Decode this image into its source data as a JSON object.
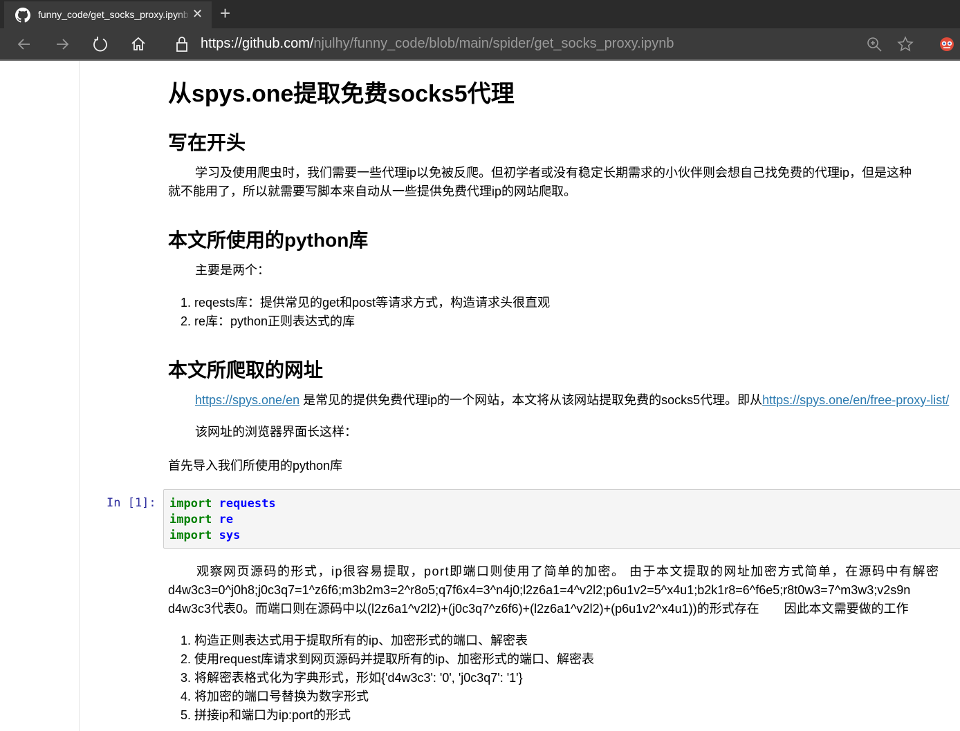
{
  "browser": {
    "tab_title": "funny_code/get_socks_proxy.ipynb",
    "tab_close": "✕",
    "new_tab": "+",
    "url_host": "https://github.com/",
    "url_path": "njulhy/funny_code/blob/main/spider/get_socks_proxy.ipynb"
  },
  "notebook": {
    "title": "从spys.one提取免费socks5代理",
    "section1_heading": "写在开头",
    "section1_para_line1": "学习及使用爬虫时，我们需要一些代理ip以免被反爬。但初学者或没有稳定长期需求的小伙伴则会想自己找免费的代理ip，但是这种",
    "section1_para_line2": "就不能用了，所以就需要写脚本来自动从一些提供免费代理ip的网站爬取。",
    "section2_heading": "本文所使用的python库",
    "section2_intro": "主要是两个：",
    "libs": [
      "reqests库：提供常见的get和post等请求方式，构造请求头很直观",
      "re库：python正则表达式的库"
    ],
    "section3_heading": "本文所爬取的网址",
    "section3_link1": "https://spys.one/en",
    "section3_text": " 是常见的提供免费代理ip的一个网站，本文将从该网站提取免费的socks5代理。即从",
    "section3_link2": "https://spys.one/en/free-proxy-list/",
    "section3_browser_note": "该网址的浏览器界面长这样：",
    "import_intro": "首先导入我们所使用的python库",
    "cell_prompt": "In [1]:",
    "code_lines": [
      {
        "keyword": "import",
        "module": "requests"
      },
      {
        "keyword": "import",
        "module": "re"
      },
      {
        "keyword": "import",
        "module": "sys"
      }
    ],
    "analysis_line1": "观察网页源码的形式，ip很容易提取，port即端口则使用了简单的加密。 由于本文提取的网址加密方式简单，在源码中有解密",
    "analysis_line2": "d4w3c3=0^j0h8;j0c3q7=1^z6f6;m3b2m3=2^r8o5;q7f6x4=3^n4j0;l2z6a1=4^v2l2;p6u1v2=5^x4u1;b2k1r8=6^f6e5;r8t0w3=7^m3w3;v2s9n",
    "analysis_line3": "d4w3c3代表0。而端口则在源码中以(l2z6a1^v2l2)+(j0c3q7^z6f6)+(l2z6a1^v2l2)+(p6u1v2^x4u1))的形式存在　　因此本文需要做的工作",
    "steps": [
      "构造正则表达式用于提取所有的ip、加密形式的端口、解密表",
      "使用request库请求到网页源码并提取所有的ip、加密形式的端口、解密表",
      "将解密表格式化为字典形式，形如{'d4w3c3': '0', 'j0c3q7': '1'}",
      "将加密的端口号替换为数字形式",
      "拼接ip和端口为ip:port的形式"
    ]
  }
}
